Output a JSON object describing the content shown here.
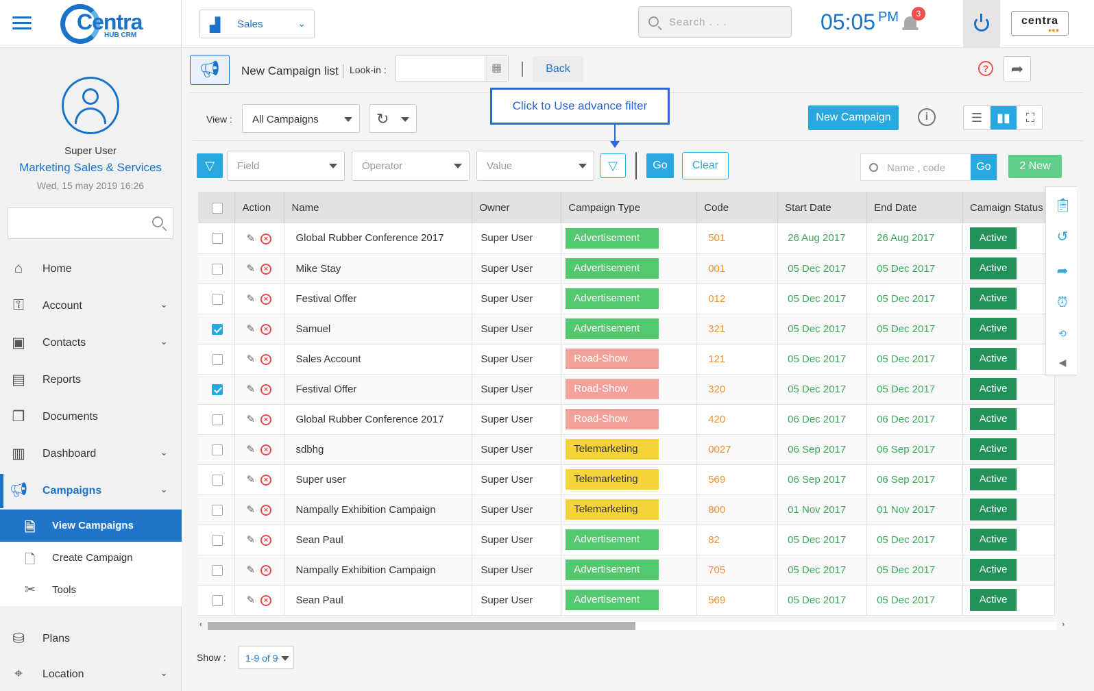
{
  "logo": {
    "word": "Centra",
    "sub": "HUB CRM"
  },
  "profile": {
    "name": "Super User",
    "role": "Marketing Sales & Services",
    "date": "Wed, 15 may 2019 16:26"
  },
  "sidebar": {
    "items": [
      {
        "label": "Home"
      },
      {
        "label": "Account"
      },
      {
        "label": "Contacts"
      },
      {
        "label": "Reports"
      },
      {
        "label": "Documents"
      },
      {
        "label": "Dashboard"
      },
      {
        "label": "Campaigns"
      },
      {
        "label": "Plans"
      },
      {
        "label": "Location"
      }
    ],
    "subitems": [
      {
        "label": "View Campaigns"
      },
      {
        "label": "Create Campaign"
      },
      {
        "label": "Tools"
      }
    ]
  },
  "topbar": {
    "module": "Sales",
    "search_placeholder": "Search . . .",
    "time": "05:05",
    "ampm": "PM",
    "notifications": "3",
    "brand": "centra",
    "brand_sub": "●●●"
  },
  "titlebar": {
    "title": "New Campaign list",
    "lookin_label": "Look-in :",
    "back": "Back",
    "help": "?"
  },
  "viewbar": {
    "label": "View :",
    "view": "All Campaigns",
    "new_campaign": "New Campaign",
    "tooltip": "Click to Use advance filter"
  },
  "filter": {
    "field": "Field",
    "operator": "Operator",
    "value": "Value",
    "go": "Go",
    "clear": "Clear",
    "quick_placeholder": "Name , code",
    "quick_go": "Go",
    "new_count": "2 New"
  },
  "table": {
    "headers": [
      "Action",
      "Name",
      "Owner",
      "Campaign Type",
      "Code",
      "Start Date",
      "End Date",
      "Camaign Status"
    ],
    "rows": [
      {
        "checked": false,
        "name": "Global Rubber Conference 2017",
        "owner": "Super User",
        "type": "Advertisement",
        "code": "501",
        "start": "26 Aug 2017",
        "end": "26 Aug 2017",
        "status": "Active"
      },
      {
        "checked": false,
        "name": "Mike Stay",
        "owner": "Super User",
        "type": "Advertisement",
        "code": "001",
        "start": "05 Dec 2017",
        "end": "05 Dec 2017",
        "status": "Active"
      },
      {
        "checked": false,
        "name": "Festival Offer",
        "owner": "Super User",
        "type": "Advertisement",
        "code": "012",
        "start": "05 Dec 2017",
        "end": "05 Dec 2017",
        "status": "Active"
      },
      {
        "checked": true,
        "name": "Samuel",
        "owner": "Super User",
        "type": "Advertisement",
        "code": "321",
        "start": "05 Dec 2017",
        "end": "05 Dec 2017",
        "status": "Active"
      },
      {
        "checked": false,
        "name": "Sales Account",
        "owner": "Super User",
        "type": "Road-Show",
        "code": "121",
        "start": "05 Dec 2017",
        "end": "05 Dec 2017",
        "status": "Active"
      },
      {
        "checked": true,
        "name": "Festival Offer",
        "owner": "Super User",
        "type": "Road-Show",
        "code": "320",
        "start": "05 Dec 2017",
        "end": "05 Dec 2017",
        "status": "Active"
      },
      {
        "checked": false,
        "name": "Global Rubber Conference 2017",
        "owner": "Super User",
        "type": "Road-Show",
        "code": "420",
        "start": "06 Dec 2017",
        "end": "06 Dec 2017",
        "status": "Active"
      },
      {
        "checked": false,
        "name": "sdbhg",
        "owner": "Super User",
        "type": "Telemarketing",
        "code": "0027",
        "start": "06 Sep 2017",
        "end": "06 Sep 2017",
        "status": "Active"
      },
      {
        "checked": false,
        "name": "Super user",
        "owner": "Super User",
        "type": "Telemarketing",
        "code": "569",
        "start": "06 Sep 2017",
        "end": "06 Sep 2017",
        "status": "Active"
      },
      {
        "checked": false,
        "name": "Nampally Exhibition Campaign",
        "owner": "Super User",
        "type": "Telemarketing",
        "code": "800",
        "start": "01 Nov 2017",
        "end": "01 Nov 2017",
        "status": "Active"
      },
      {
        "checked": false,
        "name": "Sean Paul",
        "owner": "Super User",
        "type": "Advertisement",
        "code": "82",
        "start": "05 Dec 2017",
        "end": "05 Dec 2017",
        "status": "Active"
      },
      {
        "checked": false,
        "name": "Nampally Exhibition Campaign",
        "owner": "Super User",
        "type": "Advertisement",
        "code": "705",
        "start": "05 Dec 2017",
        "end": "05 Dec 2017",
        "status": "Active"
      },
      {
        "checked": false,
        "name": "Sean Paul",
        "owner": "Super User",
        "type": "Advertisement",
        "code": "569",
        "start": "05 Dec 2017",
        "end": "05 Dec 2017",
        "status": "Active"
      }
    ]
  },
  "footer": {
    "show_label": "Show :",
    "show_value": "1-9 of 9"
  },
  "colors": {
    "primary": "#1a73c9",
    "accent": "#29a8e0",
    "advertisement": "#54c86e",
    "road_show": "#f3a29b",
    "telemarketing": "#f5d43a",
    "status_active": "#23915a",
    "code": "#f0902e",
    "date": "#3aa65a"
  }
}
